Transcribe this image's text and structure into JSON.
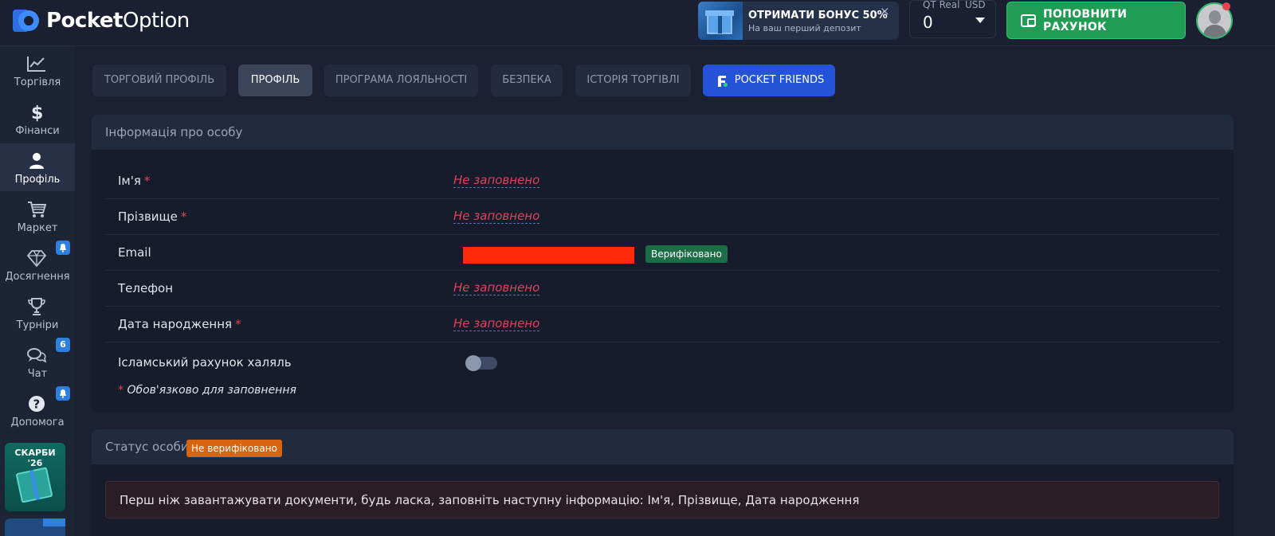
{
  "brand": {
    "name_bold": "Pocket",
    "name_light": "Option"
  },
  "header": {
    "bonus": {
      "title": "ОТРИМАТИ БОНУС 50%",
      "subtitle": "На ваш перший депозит",
      "close": "×"
    },
    "account": {
      "type": "QT Real",
      "currency": "USD",
      "balance": "0"
    },
    "topup_label": "ПОПОВНИТИ РАХУНОК",
    "notification_color": "#e8434f"
  },
  "sidebar": {
    "items": [
      {
        "label": "Торгівля",
        "icon": "chart-line-icon"
      },
      {
        "label": "Фінанси",
        "icon": "dollar-icon"
      },
      {
        "label": "Профіль",
        "icon": "user-icon",
        "active": true
      },
      {
        "label": "Маркет",
        "icon": "cart-icon"
      },
      {
        "label": "Досягнення",
        "icon": "diamond-icon",
        "badge": "bell"
      },
      {
        "label": "Турніри",
        "icon": "trophy-icon"
      },
      {
        "label": "Чат",
        "icon": "chat-icon",
        "badge": "6"
      },
      {
        "label": "Допомога",
        "icon": "help-icon",
        "badge": "bell"
      }
    ],
    "promo": {
      "title": "СКАРБИ\n'26"
    }
  },
  "tabs": [
    {
      "label": "ТОРГОВИЙ ПРОФІЛЬ"
    },
    {
      "label": "ПРОФІЛЬ",
      "active": true
    },
    {
      "label": "ПРОГРАМА ЛОЯЛЬНОСТІ"
    },
    {
      "label": "БЕЗПЕКА"
    },
    {
      "label": "ІСТОРІЯ ТОРГІВЛІ"
    },
    {
      "label": "POCKET FRIENDS"
    }
  ],
  "personal_info": {
    "title": "Інформація про особу",
    "rows": [
      {
        "label": "Ім'я",
        "required": "*",
        "value": "Не заповнено"
      },
      {
        "label": "Прізвище",
        "required": "*",
        "value": "Не заповнено"
      },
      {
        "label": "Email",
        "verified": "Верифіковано"
      },
      {
        "label": "Телефон",
        "value": "Не заповнено"
      },
      {
        "label": "Дата народження",
        "required": "*",
        "value": "Не заповнено"
      },
      {
        "label": "Ісламський рахунок халяль",
        "toggle_on": false
      }
    ],
    "required_star": "*",
    "required_note": "Обов'язково для заповнення"
  },
  "status": {
    "title": "Статус особи",
    "badge": "Не верифіковано",
    "alert": "Перш ніж завантажувати документи, будь ласка, заповніть наступну інформацію: Ім'я, Прізвище, Дата народження"
  },
  "colors": {
    "accent_green": "#1f9d55",
    "accent_blue": "#2553d8",
    "warning_orange": "#d9640f",
    "error_red": "#e0405a",
    "verified_green": "#1c6e47"
  }
}
